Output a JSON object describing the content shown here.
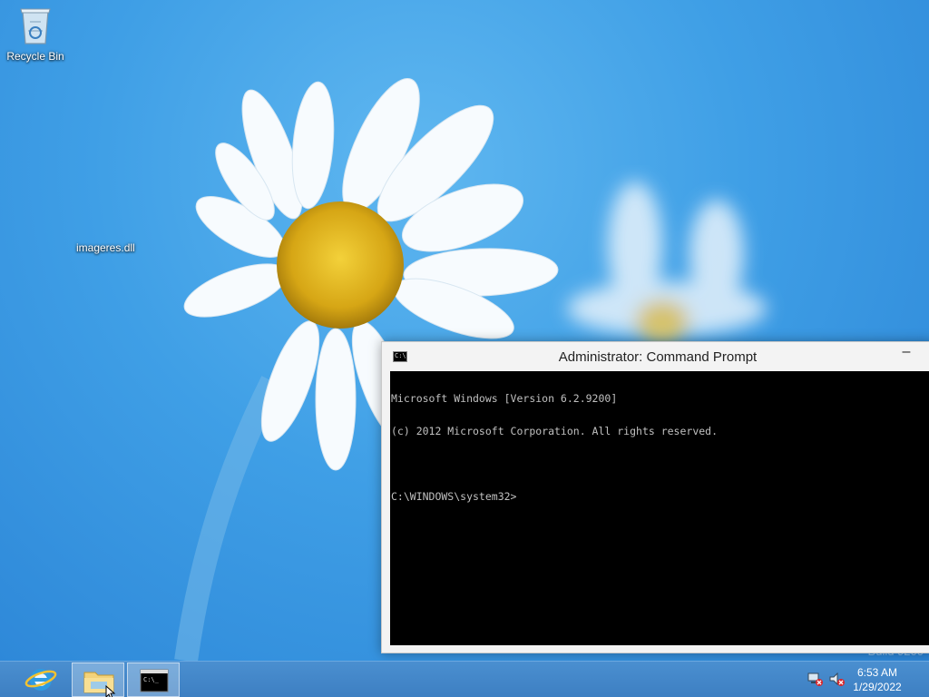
{
  "desktop": {
    "icons": [
      {
        "label": "Recycle Bin",
        "icon": "recycle-bin-icon"
      }
    ],
    "file_label": "imageres.dll",
    "watermark": "Build 9200"
  },
  "cmd": {
    "title": "Administrator: Command Prompt",
    "minimize_glyph": "–",
    "app_icon_glyph": "C:\\",
    "lines": [
      "Microsoft Windows [Version 6.2.9200]",
      "(c) 2012 Microsoft Corporation. All rights reserved.",
      "",
      "C:\\WINDOWS\\system32>"
    ]
  },
  "taskbar": {
    "buttons": [
      {
        "name": "internet-explorer",
        "icon": "internet-explorer-icon",
        "active": false
      },
      {
        "name": "file-explorer",
        "icon": "folder-icon",
        "active": true
      },
      {
        "name": "command-prompt",
        "icon": "cmd-icon",
        "active": true
      }
    ],
    "tray": {
      "icons": [
        "network-disconnected-icon",
        "volume-muted-icon"
      ],
      "time": "6:53 AM",
      "date": "1/29/2022"
    }
  },
  "colors": {
    "desktop_blue": "#3f9fe6",
    "taskbar": "#3d7fc2",
    "console_bg": "#000000",
    "console_text": "#c0c0c0"
  }
}
